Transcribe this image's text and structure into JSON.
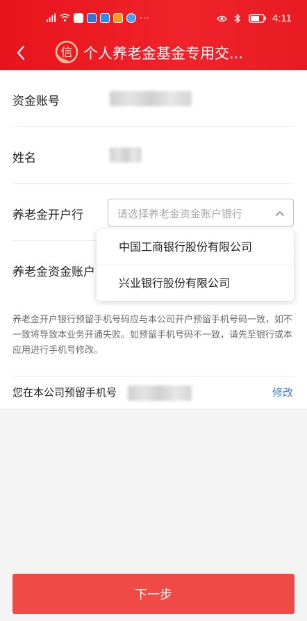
{
  "status_bar": {
    "time": "4:11",
    "left_icons": [
      "signal-icon",
      "wifi-icon",
      "app-icon",
      "app-icon",
      "app-icon",
      "app-icon",
      "app-icon"
    ],
    "more": "···",
    "right_icons": [
      "eye-icon",
      "bluetooth-icon",
      "battery-icon"
    ]
  },
  "nav": {
    "title": "个人养老金基金专用交..."
  },
  "form": {
    "account_label": "资金账号",
    "name_label": "姓名",
    "bank_label": "养老金开户行",
    "bank_select_placeholder": "请选择养老金资金账户银行",
    "fund_account_label": "养老金资金账户"
  },
  "dropdown": {
    "options": [
      "中国工商银行股份有限公司",
      "兴业银行股份有限公司"
    ]
  },
  "notice": "养老金开户银行预留手机号码应与本公司开户预留手机号码一致，如不一致将导致本业务开通失败。如预留手机号码不一致，请先至银行或本应用进行手机号修改。",
  "phone": {
    "label": "您在本公司预留手机号",
    "edit_label": "修改"
  },
  "next_button": "下一步",
  "colors": {
    "brand_red": "#e8141c",
    "button_red": "#ef4a45",
    "link_blue": "#3f7fcf"
  }
}
